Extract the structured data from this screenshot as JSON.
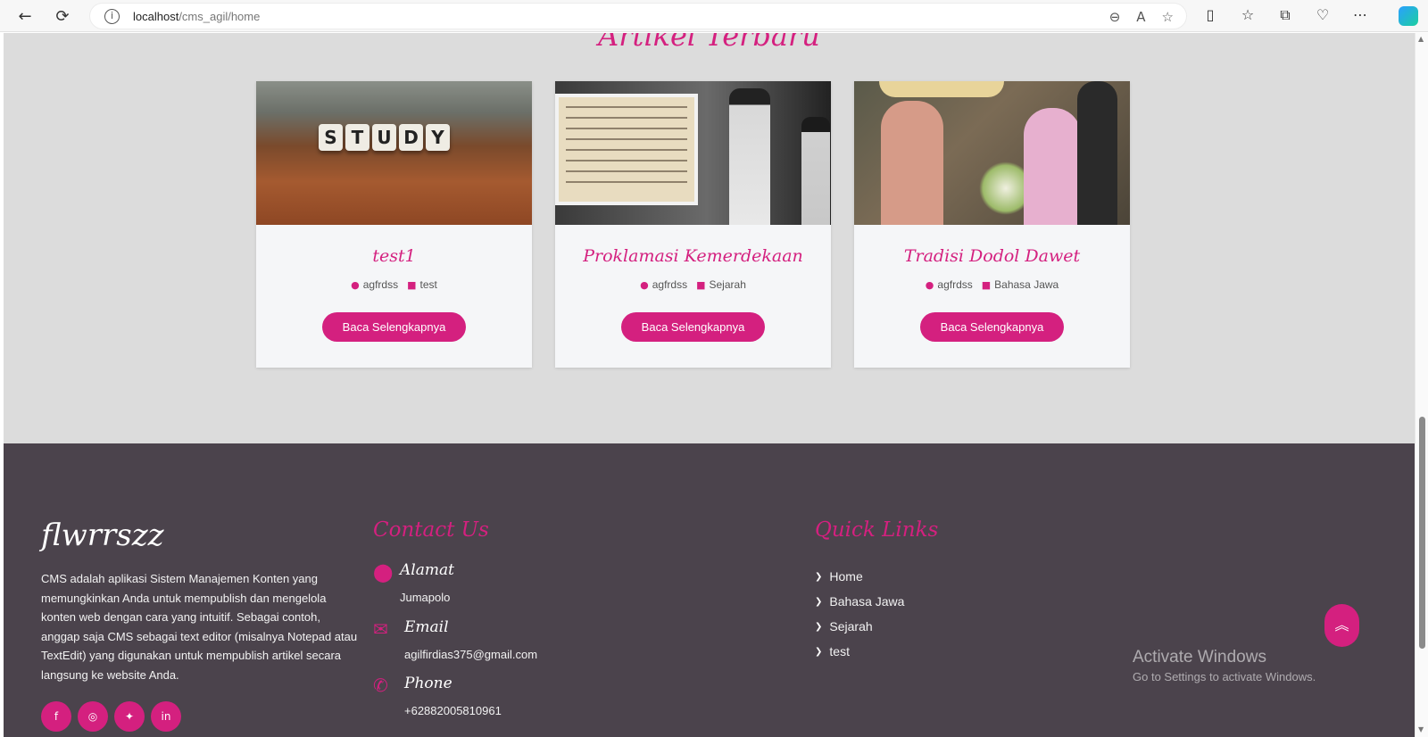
{
  "browser": {
    "url_host": "localhost",
    "url_path": "/cms_agil/home",
    "back_icon": "←",
    "refresh_icon": "⟳",
    "info_icon": "i"
  },
  "articles_section": {
    "title": "Artikel Terbaru",
    "cards": [
      {
        "title": "test1",
        "author": "agfrdss",
        "category": "test",
        "button": "Baca Selengkapnya",
        "image": "study-dice-image"
      },
      {
        "title": "Proklamasi Kemerdekaan",
        "author": "agfrdss",
        "category": "Sejarah",
        "button": "Baca Selengkapnya",
        "image": "proklamasi-photo"
      },
      {
        "title": "Tradisi Dodol Dawet",
        "author": "agfrdss",
        "category": "Bahasa Jawa",
        "button": "Baca Selengkapnya",
        "image": "tradisi-photo"
      }
    ],
    "study_dice": [
      "S",
      "T",
      "U",
      "D",
      "Y"
    ]
  },
  "footer": {
    "brand": "flwrrszz",
    "about": "CMS adalah aplikasi Sistem Manajemen Konten yang memungkinkan Anda untuk mempublish dan mengelola konten web dengan cara yang intuitif. Sebagai contoh, anggap saja CMS sebagai text editor (misalnya Notepad atau TextEdit) yang digunakan untuk mempublish artikel secara langsung ke website Anda.",
    "socials": [
      "f",
      "◎",
      "✦",
      "in"
    ],
    "contact": {
      "title": "Contact Us",
      "address_label": "Alamat",
      "address_value": "Jumapolo",
      "email_label": "Email",
      "email_value": "agilfirdias375@gmail.com",
      "phone_label": "Phone",
      "phone_value": "+62882005810961"
    },
    "quick_links": {
      "title": "Quick Links",
      "items": [
        "Home",
        "Bahasa Jawa",
        "Sejarah",
        "test"
      ]
    }
  },
  "overlay": {
    "watermark_title": "Activate Windows",
    "watermark_sub": "Go to Settings to activate Windows.",
    "to_top_icon": "︽"
  }
}
